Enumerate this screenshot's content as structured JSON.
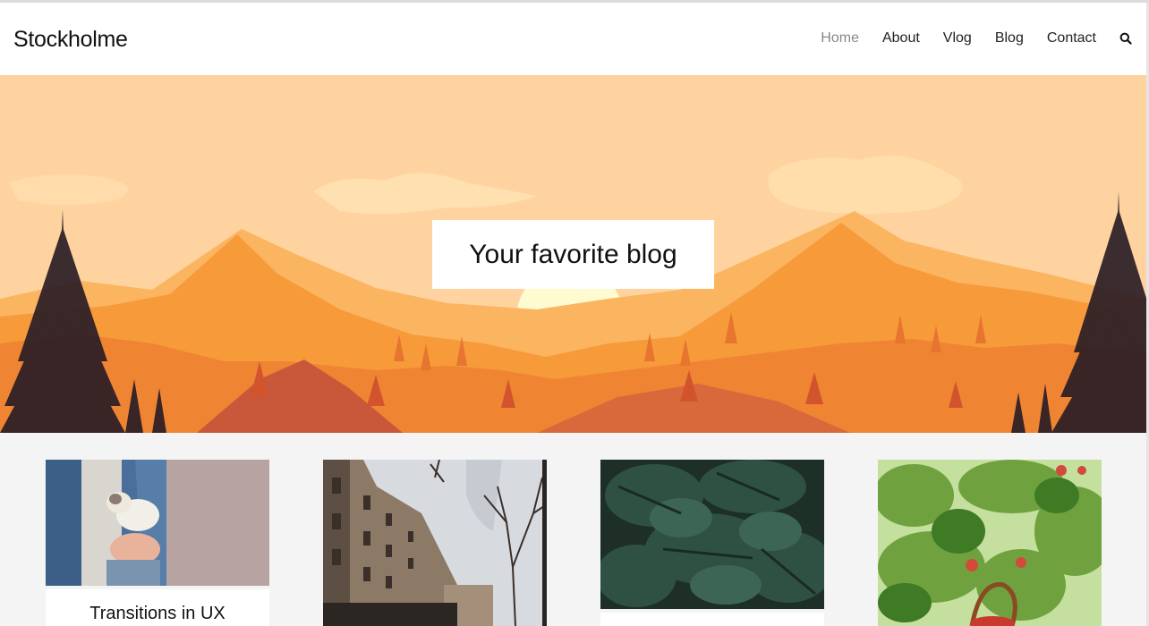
{
  "site": {
    "title": "Stockholme"
  },
  "nav": {
    "items": [
      {
        "label": "Home",
        "active": true
      },
      {
        "label": "About",
        "active": false
      },
      {
        "label": "Vlog",
        "active": false
      },
      {
        "label": "Blog",
        "active": false
      },
      {
        "label": "Contact",
        "active": false
      }
    ],
    "search_icon": "search-icon"
  },
  "hero": {
    "title": "Your favorite blog"
  },
  "posts": [
    {
      "title": "Transitions in UX",
      "image": "woman-holding-cat"
    },
    {
      "title": "",
      "image": "city-street-buildings"
    },
    {
      "title": "",
      "image": "monstera-leaves"
    },
    {
      "title": "",
      "image": "apple-tree-basket"
    }
  ],
  "colors": {
    "hero_sky": "#ffd3a0",
    "mountains": "#f79a3a",
    "active_nav": "#888888"
  }
}
